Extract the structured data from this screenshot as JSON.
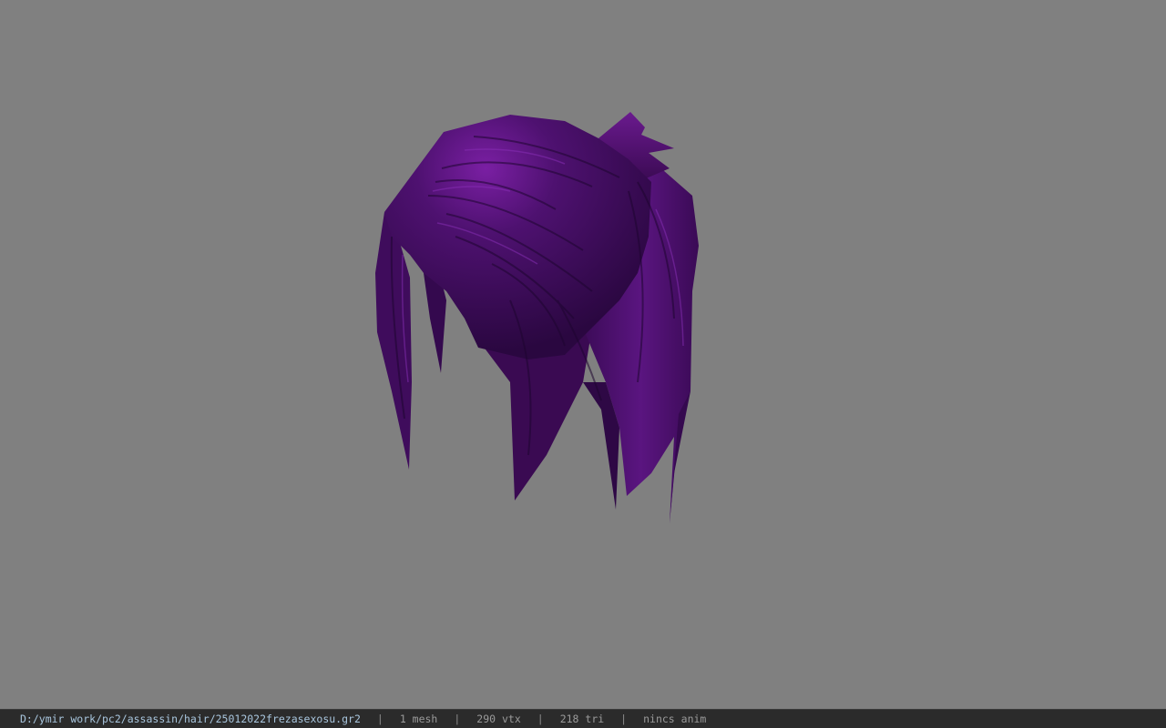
{
  "statusbar": {
    "file_path": "D:/ymir work/pc2/assassin/hair/25012022frezasexosu.gr2",
    "separator": "|",
    "mesh_count": "1 mesh",
    "vertex_count": "290 vtx",
    "triangle_count": "218 tri",
    "animation": "nincs anim"
  },
  "colors": {
    "viewport_background": "#808080",
    "hair_base": "#3a0a52",
    "hair_highlight": "#6a1a8e",
    "hair_shadow": "#1e0530",
    "statusbar_background": "#2b2b2b",
    "path_text": "#a9c6de",
    "stat_text": "#9a9a9a"
  },
  "model": {
    "icon": "hair-mesh-3d-model"
  }
}
